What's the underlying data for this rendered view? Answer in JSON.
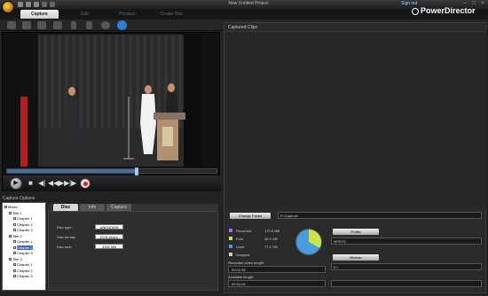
{
  "window": {
    "title": "New Untitled Project",
    "sign_out": "Sign out",
    "brand": "PowerDirector",
    "controls": [
      "–",
      "□",
      "×"
    ]
  },
  "main_tabs": [
    {
      "label": "Capture",
      "active": true
    },
    {
      "label": "Edit",
      "active": false
    },
    {
      "label": "Produce",
      "active": false
    },
    {
      "label": "Create Disc",
      "active": false
    }
  ],
  "tools": [
    {
      "icon": "capture-device-icon"
    },
    {
      "icon": "webcam-icon"
    },
    {
      "icon": "tv-tuner-icon"
    },
    {
      "icon": "digital-tv-icon"
    },
    {
      "icon": "microphone-icon"
    },
    {
      "icon": "voice-over-icon"
    },
    {
      "icon": "cd-disc-icon"
    },
    {
      "icon": "dvd-capture-icon",
      "active": true
    }
  ],
  "player": {
    "position": 0.62,
    "buttons": {
      "play": "▶",
      "stop": "■",
      "prev": "◀|",
      "rewind": "◀◀",
      "forward": "▶▶",
      "next": "|▶"
    }
  },
  "capture_options": {
    "label": "Capture Options",
    "tree": [
      {
        "text": "Movie",
        "level": 0
      },
      {
        "text": "Title 1",
        "level": 1
      },
      {
        "text": "Chapter 1",
        "level": 2
      },
      {
        "text": "Chapter 2",
        "level": 2
      },
      {
        "text": "Chapter 3",
        "level": 2
      },
      {
        "text": "Title 2",
        "level": 1
      },
      {
        "text": "Chapter 1",
        "level": 2
      },
      {
        "text": "Chapter 2",
        "level": 2,
        "selected": true
      },
      {
        "text": "Chapter 3",
        "level": 2
      },
      {
        "text": "Title 3",
        "level": 1
      },
      {
        "text": "Chapter 1",
        "level": 2
      },
      {
        "text": "Chapter 2",
        "level": 2
      },
      {
        "text": "Chapter 3",
        "level": 2
      }
    ],
    "tabs": [
      {
        "label": "Disc",
        "active": true
      },
      {
        "label": "Info",
        "active": false
      },
      {
        "label": "Capture",
        "active": false
      }
    ],
    "disc": {
      "type_label": "Disc type:",
      "type_value": "UNKNOWN",
      "format_label": "Disc format:",
      "format_value": "DVD-Video",
      "size_label": "Disc size:",
      "size_value": "4330 MB"
    }
  },
  "captured_clips": {
    "header": "Captured Clips",
    "change_folder": "Change Folder",
    "folder_path": "E:\\Capture\\",
    "legend": [
      {
        "name": "Recorded",
        "value": "170.5 MB",
        "color": "#c060ff"
      },
      {
        "name": "Free",
        "value": "38.4 GB",
        "color": "#c8e64c"
      },
      {
        "name": "Used",
        "value": "77.2 GB",
        "color": "#4a9ce0"
      },
      {
        "name": "Dropped",
        "value": "",
        "color": "#cccccc"
      }
    ],
    "recorded_length_label": "Recorded video length:",
    "recorded_length": "00:02:35",
    "available_length_label": "Available length:",
    "available_length": "00:54:54",
    "profile_button": "Profile",
    "profile_value": "MPEG2",
    "browse_button": "Browse",
    "browse_value": "E:\\"
  }
}
